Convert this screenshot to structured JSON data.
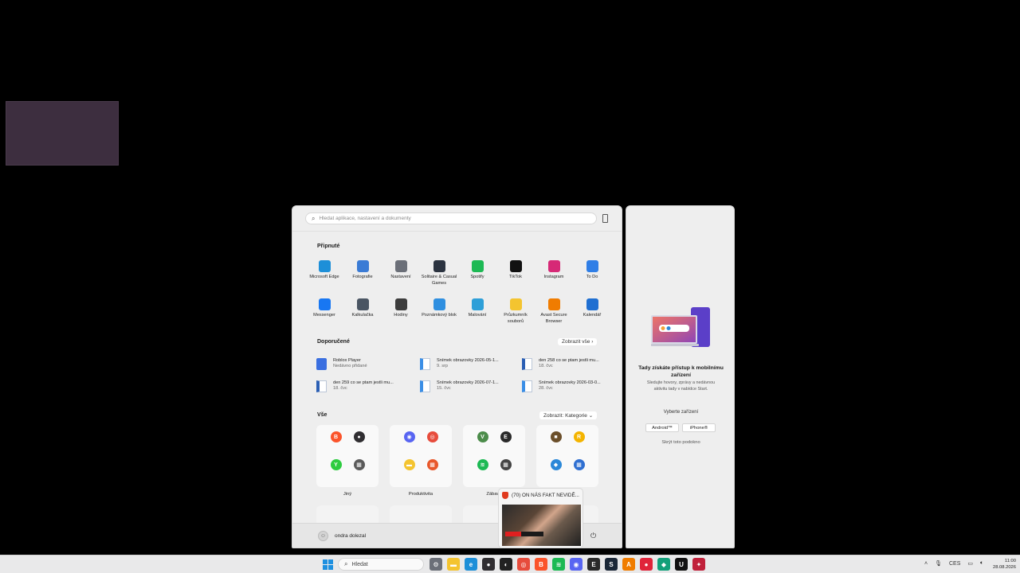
{
  "start_menu": {
    "search_placeholder": "Hledat aplikace, nastavení a dokumenty",
    "pinned_title": "Připnuté",
    "pinned": [
      {
        "label": "Microsoft Edge",
        "icon": "edge-icon",
        "color": "#1d8fd8"
      },
      {
        "label": "Fotografie",
        "icon": "photos-icon",
        "color": "#3a7bd5"
      },
      {
        "label": "Nastavení",
        "icon": "gear-icon",
        "color": "#6b6f78"
      },
      {
        "label": "Solitaire & Casual Games",
        "icon": "cards-icon",
        "color": "#2b3340"
      },
      {
        "label": "Spotify",
        "icon": "spotify-icon",
        "color": "#1db954"
      },
      {
        "label": "TikTok",
        "icon": "tiktok-icon",
        "color": "#111111"
      },
      {
        "label": "Instagram",
        "icon": "instagram-icon",
        "color": "#d62976"
      },
      {
        "label": "To Do",
        "icon": "check-icon",
        "color": "#2f7ee6"
      },
      {
        "label": "Messenger",
        "icon": "messenger-icon",
        "color": "#1877f2"
      },
      {
        "label": "Kalkulačka",
        "icon": "calculator-icon",
        "color": "#4a5563"
      },
      {
        "label": "Hodiny",
        "icon": "clock-icon",
        "color": "#3c3c3c"
      },
      {
        "label": "Poznámkový blok",
        "icon": "notepad-icon",
        "color": "#2f8fe0"
      },
      {
        "label": "Malování",
        "icon": "paint-icon",
        "color": "#2e9fd8"
      },
      {
        "label": "Průzkumník souborů",
        "icon": "folder-icon",
        "color": "#f4c430"
      },
      {
        "label": "Avast Secure Browser",
        "icon": "avast-icon",
        "color": "#f07c00"
      },
      {
        "label": "Kalendář",
        "icon": "calendar-icon",
        "color": "#1f6fd1"
      }
    ],
    "recommended_title": "Doporučené",
    "show_all": "Zobrazit vše  ›",
    "recommended": [
      {
        "title": "Roblox Player",
        "sub": "Nedávno přidané",
        "icon": "roblox-icon"
      },
      {
        "title": "Snímek obrazovky 2026-05-1...",
        "sub": "9. srp",
        "icon": "image-file-icon"
      },
      {
        "title": "den 258 co se ptam jestli mu...",
        "sub": "18. čvc",
        "icon": "word-file-icon"
      },
      {
        "title": "den 259 co se ptam jestli mu...",
        "sub": "18. čvc",
        "icon": "word-file-icon"
      },
      {
        "title": "Snímek obrazovky 2026-07-1...",
        "sub": "15. čvc",
        "icon": "image-file-icon"
      },
      {
        "title": "Snímek obrazovky 2026-03-0...",
        "sub": "28. čvc",
        "icon": "image-file-icon"
      }
    ],
    "all_title": "Vše",
    "view_by": "Zobrazit: Kategorie  ⌄",
    "categories": [
      {
        "label": "Jiný",
        "icons": [
          {
            "name": "brave-icon",
            "color": "#fb542b",
            "glyph": "B"
          },
          {
            "name": "obs-icon",
            "color": "#302e31",
            "glyph": "●"
          },
          {
            "name": "app-green-icon",
            "color": "#2ecc40",
            "glyph": "Y"
          },
          {
            "name": "apps-grid-icon",
            "color": "#5a5a5a",
            "glyph": "▦"
          }
        ]
      },
      {
        "label": "Produktivita",
        "icons": [
          {
            "name": "discord-icon",
            "color": "#5865f2",
            "glyph": "◉"
          },
          {
            "name": "chrome-icon",
            "color": "#e74c3c",
            "glyph": "◎"
          },
          {
            "name": "folder-icon",
            "color": "#f4c430",
            "glyph": "▬"
          },
          {
            "name": "office-icon",
            "color": "#e8572a",
            "glyph": "▦"
          }
        ]
      },
      {
        "label": "Zábava",
        "icons": [
          {
            "name": "vivaldi-icon",
            "color": "#4c8c4a",
            "glyph": "V"
          },
          {
            "name": "epic-games-icon",
            "color": "#2a2a2a",
            "glyph": "E"
          },
          {
            "name": "spotify-icon",
            "color": "#1db954",
            "glyph": "≋"
          },
          {
            "name": "games-grid-icon",
            "color": "#444444",
            "glyph": "▦"
          }
        ]
      },
      {
        "label": "",
        "icons": [
          {
            "name": "minecraft-icon",
            "color": "#6b4f2a",
            "glyph": "■"
          },
          {
            "name": "rockstar-icon",
            "color": "#f4b400",
            "glyph": "R"
          },
          {
            "name": "app-blue-icon",
            "color": "#2b88d8",
            "glyph": "◆"
          },
          {
            "name": "store-grid-icon",
            "color": "#2f6fd1",
            "glyph": "▦"
          }
        ]
      }
    ],
    "username": "ondra dolezal"
  },
  "side_panel": {
    "title": "Tady získáte přístup k mobilnímu zařízení",
    "description": "Sledujte hovory, zprávy a nedávnou aktivitu tady v nabídce Start.",
    "choose": "Vyberte zařízení",
    "android": "Android™",
    "iphone": "iPhone®",
    "hide": "Skrýt toto podokno"
  },
  "preview": {
    "title": "(70) ON NÁS FAKT NEVIDĚ..."
  },
  "taskbar": {
    "search": "Hledat",
    "icons": [
      {
        "name": "settings-icon",
        "color": "#6b6f78",
        "glyph": "⚙"
      },
      {
        "name": "file-explorer-icon",
        "color": "#f4c430",
        "glyph": "▬"
      },
      {
        "name": "edge-icon",
        "color": "#1d8fd8",
        "glyph": "e"
      },
      {
        "name": "obs-icon",
        "color": "#302e31",
        "glyph": "●"
      },
      {
        "name": "app-dark-icon",
        "color": "#222222",
        "glyph": "◐"
      },
      {
        "name": "chrome-icon",
        "color": "#e74c3c",
        "glyph": "◎"
      },
      {
        "name": "brave-icon",
        "color": "#fb542b",
        "glyph": "B"
      },
      {
        "name": "spotify-icon",
        "color": "#1db954",
        "glyph": "≋"
      },
      {
        "name": "discord-icon",
        "color": "#5865f2",
        "glyph": "◉"
      },
      {
        "name": "epic-games-icon",
        "color": "#2a2a2a",
        "glyph": "E"
      },
      {
        "name": "steam-icon",
        "color": "#1b2838",
        "glyph": "S"
      },
      {
        "name": "avast-icon",
        "color": "#f07c00",
        "glyph": "A"
      },
      {
        "name": "app-red-icon",
        "color": "#e0243a",
        "glyph": "●"
      },
      {
        "name": "app-teal-icon",
        "color": "#12a07a",
        "glyph": "◆"
      },
      {
        "name": "unreal-icon",
        "color": "#111111",
        "glyph": "U"
      },
      {
        "name": "app-pink-icon",
        "color": "#c0203a",
        "glyph": "✦"
      }
    ],
    "language": "CES",
    "time": "11:00",
    "date": "28.08.2026"
  }
}
